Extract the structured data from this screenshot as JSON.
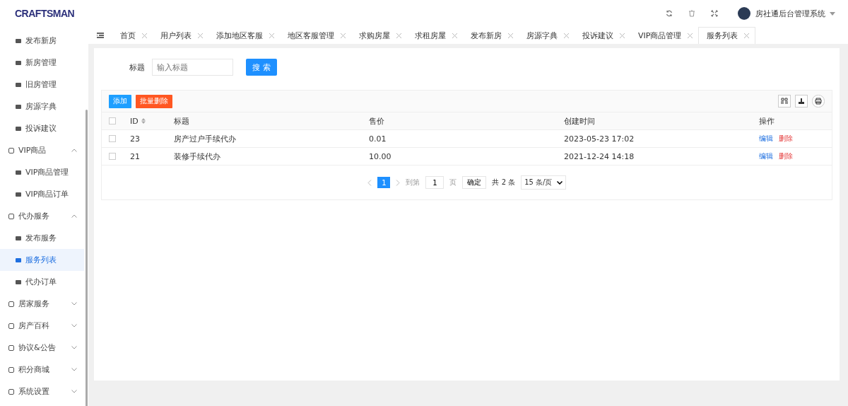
{
  "header": {
    "logo": "CRAFTSMAN",
    "user": "房社通后台管理系统"
  },
  "sidebar": {
    "leading_items": [
      {
        "label": "发布新房",
        "selected": false
      },
      {
        "label": "新房管理",
        "selected": false
      },
      {
        "label": "旧房管理",
        "selected": false
      },
      {
        "label": "房源字典",
        "selected": false
      },
      {
        "label": "投诉建议",
        "selected": false
      }
    ],
    "groups": [
      {
        "label": "VIP商品",
        "expanded": true,
        "children": [
          {
            "label": "VIP商品管理",
            "selected": false
          },
          {
            "label": "VIP商品订单",
            "selected": false
          }
        ]
      },
      {
        "label": "代办服务",
        "expanded": true,
        "children": [
          {
            "label": "发布服务",
            "selected": false
          },
          {
            "label": "服务列表",
            "selected": true
          },
          {
            "label": "代办订单",
            "selected": false
          }
        ]
      },
      {
        "label": "居家服务",
        "expanded": false
      },
      {
        "label": "房产百科",
        "expanded": false
      },
      {
        "label": "协议&公告",
        "expanded": false
      },
      {
        "label": "积分商城",
        "expanded": false
      },
      {
        "label": "系统设置",
        "expanded": false
      }
    ]
  },
  "tabs": [
    {
      "label": "首页",
      "selected": false
    },
    {
      "label": "用户列表",
      "selected": false
    },
    {
      "label": "添加地区客服",
      "selected": false
    },
    {
      "label": "地区客服管理",
      "selected": false
    },
    {
      "label": "求购房屋",
      "selected": false
    },
    {
      "label": "求租房屋",
      "selected": false
    },
    {
      "label": "发布新房",
      "selected": false
    },
    {
      "label": "房源字典",
      "selected": false
    },
    {
      "label": "投诉建议",
      "selected": false
    },
    {
      "label": "VIP商品管理",
      "selected": false
    },
    {
      "label": "服务列表",
      "selected": true
    }
  ],
  "search": {
    "label": "标题",
    "placeholder": "输入标题",
    "button": "搜 索"
  },
  "toolbar": {
    "add": "添加",
    "batch_delete": "批量删除"
  },
  "table": {
    "all_checked": false,
    "columns": [
      "ID",
      "标题",
      "售价",
      "创建时间",
      "操作"
    ],
    "rows": [
      {
        "checked": false,
        "cells": [
          "23",
          "房产过户手续代办",
          "0.01",
          "2023-05-23 17:02"
        ],
        "actions": [
          "编辑",
          "删除"
        ]
      },
      {
        "checked": false,
        "cells": [
          "21",
          "装修手续代办",
          "10.00",
          "2021-12-24 14:18"
        ],
        "actions": [
          "编辑",
          "删除"
        ]
      }
    ]
  },
  "pagination": {
    "pages": [
      {
        "label": "1",
        "selected": true
      }
    ],
    "goto_label": "到第",
    "goto_value": "1",
    "page_unit": "页",
    "confirm": "确定",
    "total": "共 2 条",
    "page_size": "15 条/页"
  }
}
